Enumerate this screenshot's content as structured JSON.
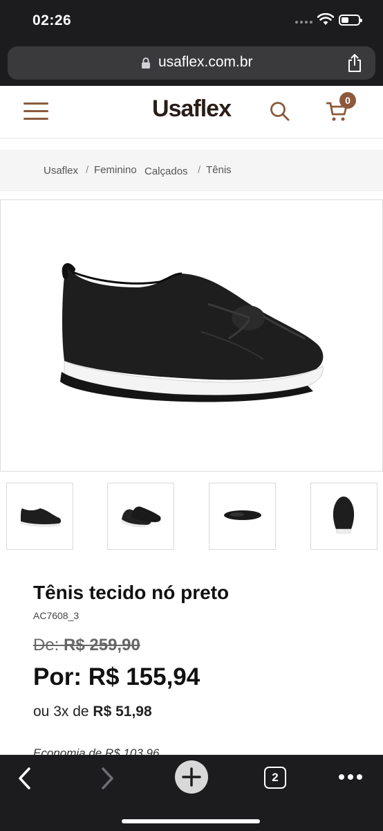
{
  "status_bar": {
    "time": "02:26"
  },
  "browser": {
    "url": "usaflex.com.br",
    "tab_count": "2"
  },
  "header": {
    "logo": "Usaflex",
    "cart_count": "0"
  },
  "breadcrumb": [
    {
      "label": "Usaflex"
    },
    {
      "label": "Feminino"
    },
    {
      "label": "Calçados"
    },
    {
      "label": "Tênis"
    }
  ],
  "product": {
    "title": "Tênis tecido nó preto",
    "sku": "AC7608_3",
    "old_price_label": "De:",
    "old_price_value": "R$ 259,90",
    "new_price": "Por: R$ 155,94",
    "installments_prefix": "ou 3x de",
    "installments_value": "R$ 51,98",
    "savings": "Economia de R$ 103,96"
  },
  "thumbnails": [
    {
      "name": "side-view"
    },
    {
      "name": "pair-view"
    },
    {
      "name": "sole-view"
    },
    {
      "name": "back-view"
    }
  ],
  "colors": {
    "brand": "#8b5a3c",
    "logo": "#2a1d17",
    "chrome": "#1c1c1e"
  }
}
